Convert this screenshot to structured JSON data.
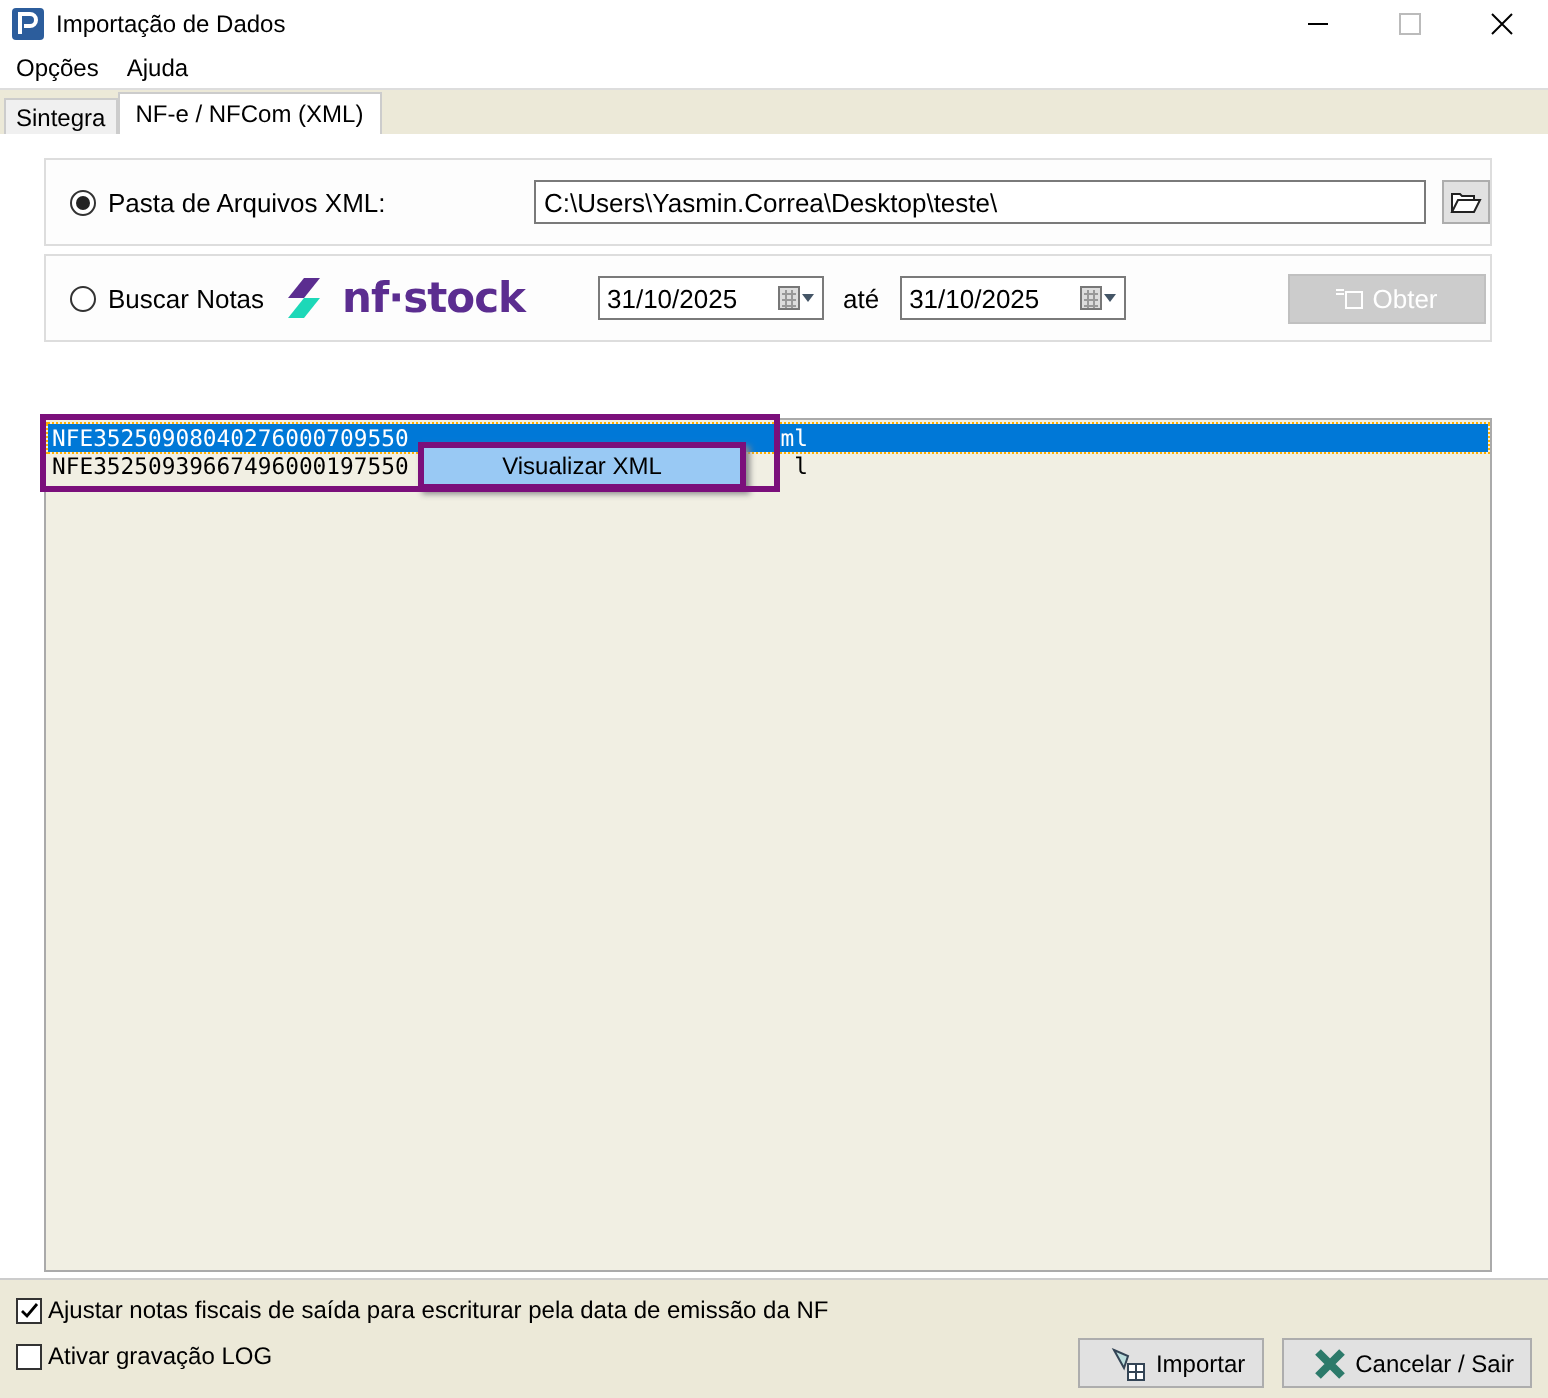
{
  "window": {
    "title": "Importação de Dados"
  },
  "menu": [
    "Opções",
    "Ajuda"
  ],
  "tabs": [
    {
      "label": "Sintegra",
      "selected": false
    },
    {
      "label": "NF-e / NFCom (XML)",
      "selected": true
    }
  ],
  "source_options": [
    {
      "kind": "folder",
      "label": "Pasta de Arquivos XML:",
      "selected": true,
      "value": "C:\\Users\\Yasmin.Correa\\Desktop\\teste\\"
    },
    {
      "kind": "search",
      "label": "Buscar Notas",
      "selected": false,
      "logo": "nf·stock",
      "date_from": "31/10/2025",
      "between": "até",
      "date_to": "31/10/2025",
      "button": {
        "label": "Obter",
        "disabled": true
      }
    }
  ],
  "files": [
    {
      "start": "NFE35250908040276000709550",
      "end": "ml",
      "selected": true
    },
    {
      "start": "NFE35250939667496000197550",
      "end": "l",
      "selected": false
    }
  ],
  "context_menu": {
    "items": [
      "Visualizar XML"
    ]
  },
  "options": [
    {
      "label": "Ajustar notas fiscais de saída para escriturar pela data de emissão da NF",
      "checked": true
    },
    {
      "label": "Ativar gravação LOG",
      "checked": false
    }
  ],
  "buttons": [
    {
      "kind": "import",
      "label": "Importar"
    },
    {
      "kind": "cancel",
      "label": "Cancelar / Sair"
    }
  ]
}
